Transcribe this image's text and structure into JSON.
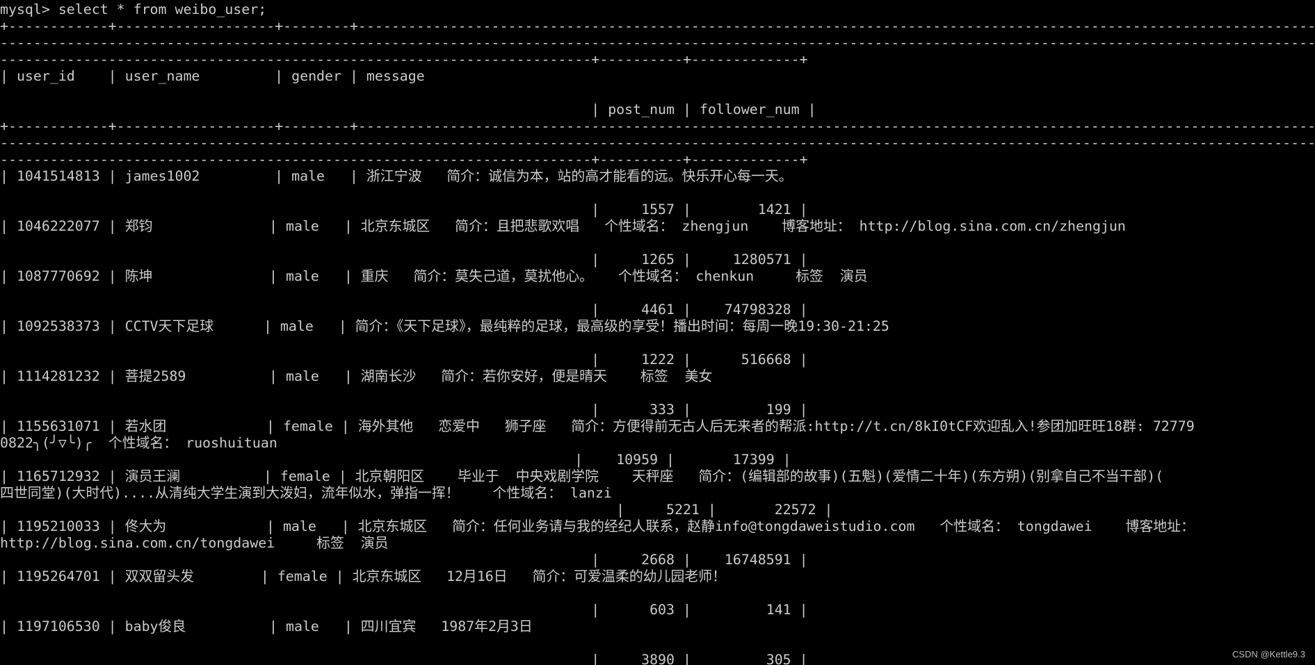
{
  "terminal": {
    "background": "#000000",
    "foreground": "#cccccc",
    "lines": [
      "mysql> select * from weibo_user;",
      "+------------+-------------------+--------+-----------------------------------------------------------------------------------------------------------------------------",
      "-----------------------------------------------------------------------------------------------------------------------------------------------------------------",
      "-----------------------------------------------------------------------+----------+-------------+",
      "| user_id    | user_name         | gender | message",
      "",
      "                                                                       | post_num | follower_num |",
      "+------------+-------------------+--------+-----------------------------------------------------------------------------------------------------------------------------",
      "-----------------------------------------------------------------------------------------------------------------------------------------------------------------",
      "-----------------------------------------------------------------------+----------+-------------+",
      "| 1041514813 | james1002         | male   | 浙江宁波   简介：诚信为本，站的高才能看的远。快乐开心每一天。",
      "",
      "                                                                       |     1557 |        1421 |",
      "| 1046222077 | 郑钧              | male   | 北京东城区   简介：且把悲歌欢唱   个性域名： zhengjun    博客地址： http://blog.sina.com.cn/zhengjun",
      "",
      "                                                                       |     1265 |     1280571 |",
      "| 1087770692 | 陈坤              | male   | 重庆   简介：莫失己道，莫扰他心。   个性域名： chenkun     标签  演员",
      "",
      "                                                                       |     4461 |    74798328 |",
      "| 1092538373 | CCTV天下足球      | male   | 简介：《天下足球》，最纯粹的足球，最高级的享受！播出时间：每周一晚19:30-21:25",
      "",
      "                                                                       |     1222 |      516668 |",
      "| 1114281232 | 菩提2589          | male   | 湖南长沙   简介：若你安好，便是晴天    标签  美女",
      "",
      "                                                                       |      333 |         199 |",
      "| 1155631071 | 若水团            | female | 海外其他   恋爱中   狮子座   简介：方便得前无古人后无来者的帮派:http://t.cn/8kI0tCF欢迎乱入!参团加旺旺18群: 72779",
      "0822╮(╯▽╰)╭  个性域名： ruoshuituan",
      "                                                                     |    10959 |       17399 |",
      "| 1165712932 | 演员王澜          | female | 北京朝阳区    毕业于  中央戏剧学院    天秤座   简介：(编辑部的故事)(五魁)(爱情二十年)(东方朔)(别拿自己不当干部)(",
      "四世同堂)(大时代)....从清纯大学生演到大泼妇，流年似水，弹指一挥！    个性域名： lanzi",
      "                                                                          |     5221 |       22572 |",
      "| 1195210033 | 佟大为            | male   | 北京东城区   简介：任何业务请与我的经纪人联系，赵静info@tongdaweistudio.com   个性域名： tongdawei    博客地址：",
      "http://blog.sina.com.cn/tongdawei     标签  演员",
      "                                                                       |     2668 |    16748591 |",
      "| 1195264701 | 双双留头发        | female | 北京东城区   12月16日   简介：可爱温柔的幼儿园老师！",
      "",
      "                                                                       |      603 |         141 |",
      "| 1197106530 | baby俊良          | male   | 四川宜宾   1987年2月3日",
      "",
      "                                                                       |     3890 |         305 |"
    ]
  },
  "watermark": "CSDN @Kettle9.3"
}
